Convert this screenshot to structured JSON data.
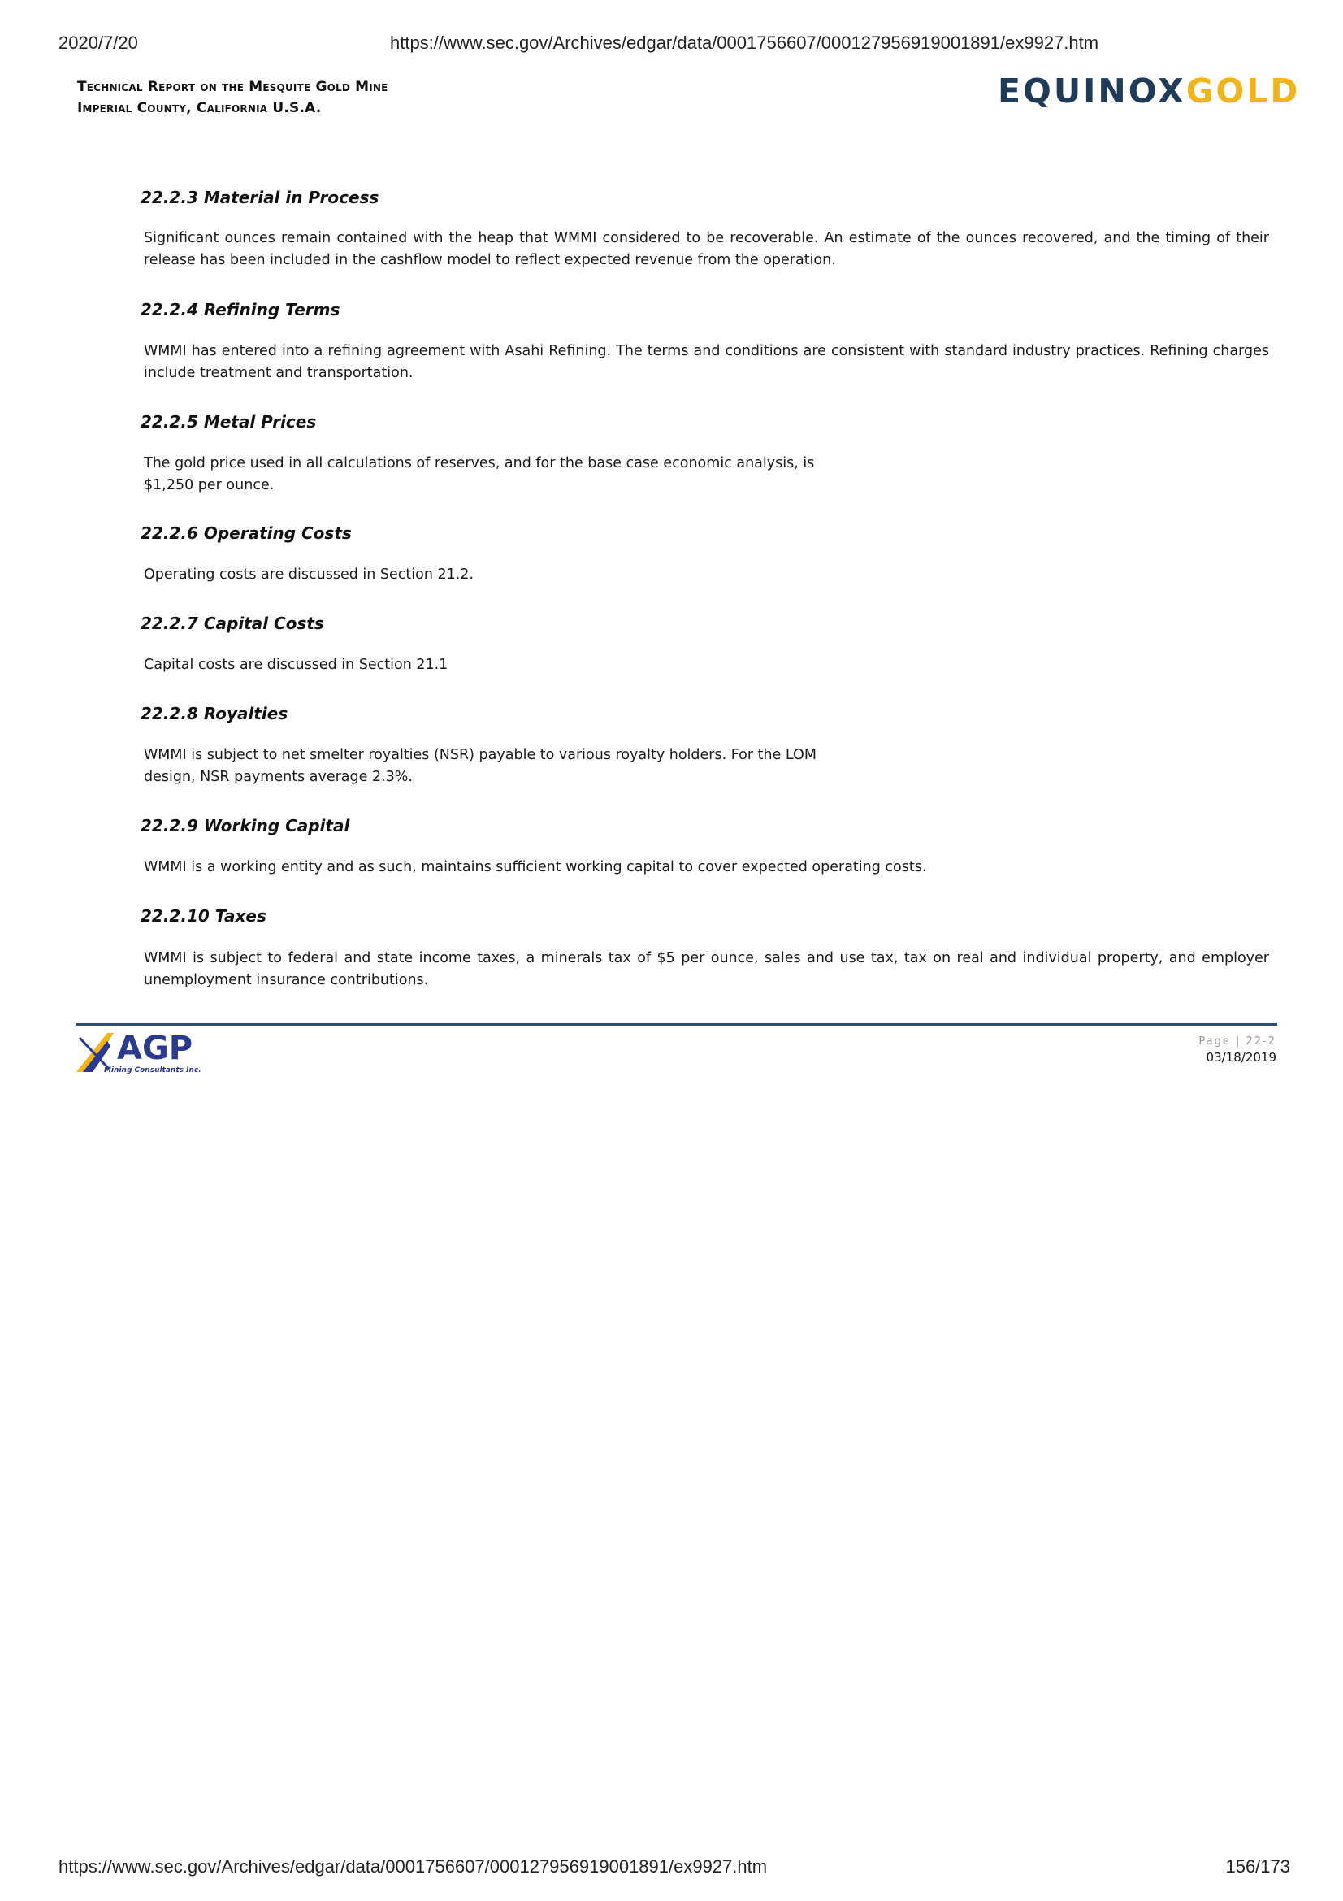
{
  "print_header": {
    "date": "2020/7/20",
    "url": "https://www.sec.gov/Archives/edgar/data/0001756607/000127956919001891/ex9927.htm"
  },
  "report_header": {
    "title_line1": "Technical Report on the Mesquite Gold Mine",
    "title_line2": "Imperial County, California U.S.A.",
    "logo_part1": "EQUINOX",
    "logo_part2": "GOLD",
    "logo_colors": {
      "part1": "#1f3b57",
      "part2": "#f0b51c"
    }
  },
  "sections": [
    {
      "heading": "22.2.3 Material in Process",
      "body": "Significant ounces remain contained with the heap that WMMI considered to be recoverable. An estimate of the ounces recovered, and the timing of their release has been included in the cashflow model to reflect expected revenue from the operation."
    },
    {
      "heading": "22.2.4 Refining Terms",
      "body": "WMMI has entered into a refining agreement with Asahi Refining. The terms and conditions are consistent with standard industry practices. Refining charges include treatment and transportation."
    },
    {
      "heading": "22.2.5 Metal Prices",
      "body": "The gold price used in all calculations of reserves, and for the base case economic analysis, is $1,250 per ounce."
    },
    {
      "heading": "22.2.6 Operating Costs",
      "body": "Operating costs are discussed in Section 21.2."
    },
    {
      "heading": "22.2.7 Capital Costs",
      "body": "Capital costs are discussed in Section 21.1"
    },
    {
      "heading": "22.2.8 Royalties",
      "body": "WMMI is subject to net smelter royalties (NSR) payable to various royalty holders. For the LOM design, NSR payments average 2.3%."
    },
    {
      "heading": "22.2.9 Working Capital",
      "body": "WMMI is a working entity and as such, maintains sufficient working capital to cover expected operating costs."
    },
    {
      "heading": "22.2.10 Taxes",
      "body": "WMMI is subject to federal and state income taxes, a minerals tax of $5 per ounce, sales and use tax, tax on real and individual property, and employer unemployment insurance contributions."
    }
  ],
  "report_footer": {
    "agp_logo_text": "AGP",
    "agp_logo_subtext": "Mining Consultants Inc.",
    "page_label": "Page | 22-2",
    "date": "03/18/2019",
    "rule_color": "#2b4f7a"
  },
  "print_footer": {
    "url": "https://www.sec.gov/Archives/edgar/data/0001756607/000127956919001891/ex9927.htm",
    "pages": "156/173"
  }
}
